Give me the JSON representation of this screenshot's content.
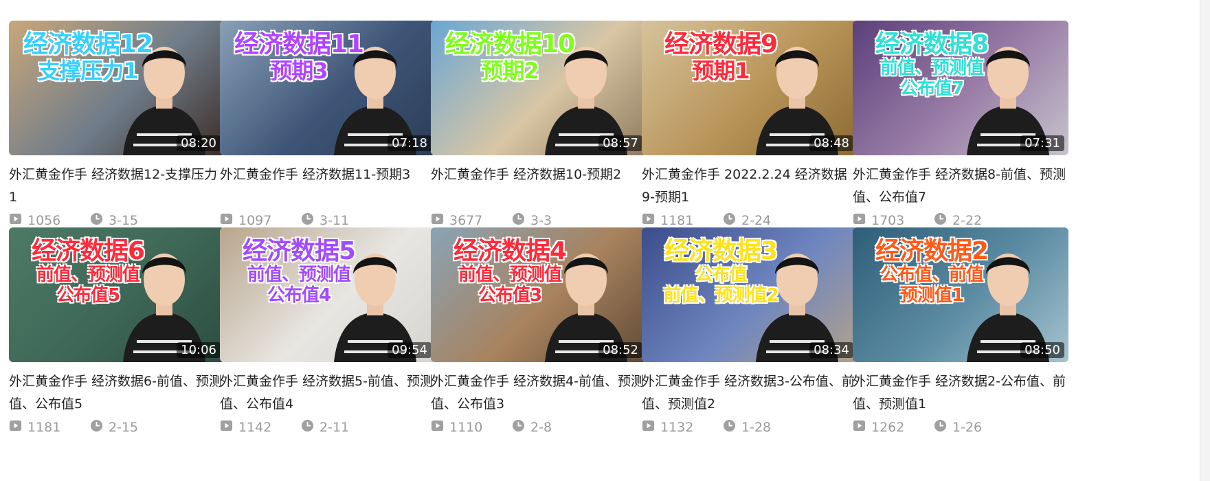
{
  "videos": [
    {
      "title": "外汇黄金作手 经济数据12-支撑压力1",
      "views": "1056",
      "date": "3-15",
      "duration": "08:20",
      "overlay": [
        "经济数据12",
        "支撑压力1"
      ],
      "overlay_colors": [
        "#35d0ff",
        "#35d0ff"
      ],
      "bg": [
        "#c9a77a",
        "#6f7c8a",
        "#3d2c25"
      ]
    },
    {
      "title": "外汇黄金作手 经济数据11-预期3",
      "views": "1097",
      "date": "3-11",
      "duration": "07:18",
      "overlay": [
        "经济数据11",
        "预期3"
      ],
      "overlay_colors": [
        "#b044ff",
        "#b044ff"
      ],
      "bg": [
        "#8aa0b8",
        "#3e5577",
        "#2b3d56"
      ]
    },
    {
      "title": "外汇黄金作手 经济数据10-预期2",
      "views": "3677",
      "date": "3-3",
      "duration": "08:57",
      "overlay": [
        "经济数据10",
        "预期2"
      ],
      "overlay_colors": [
        "#7dff1a",
        "#7dff1a"
      ],
      "bg": [
        "#6aa6d4",
        "#d9c6a4",
        "#8e7a5e"
      ]
    },
    {
      "title": "外汇黄金作手 2022.2.24 经济数据9-预期1",
      "views": "1181",
      "date": "2-24",
      "duration": "08:48",
      "overlay": [
        "经济数据9",
        "预期1"
      ],
      "overlay_colors": [
        "#ff2a3a",
        "#ff2a3a"
      ],
      "bg": [
        "#d6c39c",
        "#b89357",
        "#8a6a34"
      ]
    },
    {
      "title": "外汇黄金作手 经济数据8-前值、预测值、公布值7",
      "views": "1703",
      "date": "2-22",
      "duration": "07:31",
      "overlay": [
        "经济数据8",
        "前值、预测值",
        "公布值7"
      ],
      "overlay_colors": [
        "#2fe0d8",
        "#2fe0d8",
        "#2fe0d8"
      ],
      "bg": [
        "#5b3f7a",
        "#9b7fa8",
        "#c7c4cc"
      ]
    },
    {
      "title": "外汇黄金作手 经济数据6-前值、预测值、公布值5",
      "views": "1181",
      "date": "2-15",
      "duration": "10:06",
      "overlay": [
        "经济数据6",
        "前值、预测值",
        "公布值5"
      ],
      "overlay_colors": [
        "#ff2a3a",
        "#ff2a3a",
        "#ff2a3a"
      ],
      "bg": [
        "#4d7a66",
        "#3d6656",
        "#2c4d40"
      ]
    },
    {
      "title": "外汇黄金作手 经济数据5-前值、预测值、公布值4",
      "views": "1142",
      "date": "2-11",
      "duration": "09:54",
      "overlay": [
        "经济数据5",
        "前值、预测值",
        "公布值4"
      ],
      "overlay_colors": [
        "#a24cff",
        "#a24cff",
        "#a24cff"
      ],
      "bg": [
        "#b8a58c",
        "#e8e6e2",
        "#d6d4d0"
      ]
    },
    {
      "title": "外汇黄金作手 经济数据4-前值、预测值、公布值3",
      "views": "1110",
      "date": "2-8",
      "duration": "08:52",
      "overlay": [
        "经济数据4",
        "前值、预测值",
        "公布值3"
      ],
      "overlay_colors": [
        "#ff2a3a",
        "#ff2a3a",
        "#ff2a3a"
      ],
      "bg": [
        "#8aa3b6",
        "#a8825d",
        "#5f4a37"
      ]
    },
    {
      "title": "外汇黄金作手 经济数据3-公布值、前值、预测值2",
      "views": "1132",
      "date": "1-28",
      "duration": "08:34",
      "overlay": [
        "经济数据3",
        "公布值",
        "前值、预测值2"
      ],
      "overlay_colors": [
        "#ffe21a",
        "#ffe21a",
        "#ffe21a"
      ],
      "bg": [
        "#3b4d8a",
        "#6f86c0",
        "#b3a28b"
      ]
    },
    {
      "title": "外汇黄金作手 经济数据2-公布值、前值、预测值1",
      "views": "1262",
      "date": "1-26",
      "duration": "08:50",
      "overlay": [
        "经济数据2",
        "公布值、前值",
        "预测值1"
      ],
      "overlay_colors": [
        "#ff5a1a",
        "#ff5a1a",
        "#ff5a1a"
      ],
      "bg": [
        "#2e5d78",
        "#5d8da4",
        "#a7c3cf"
      ]
    }
  ],
  "icons": {
    "views": "play-count-icon",
    "date": "clock-icon"
  }
}
